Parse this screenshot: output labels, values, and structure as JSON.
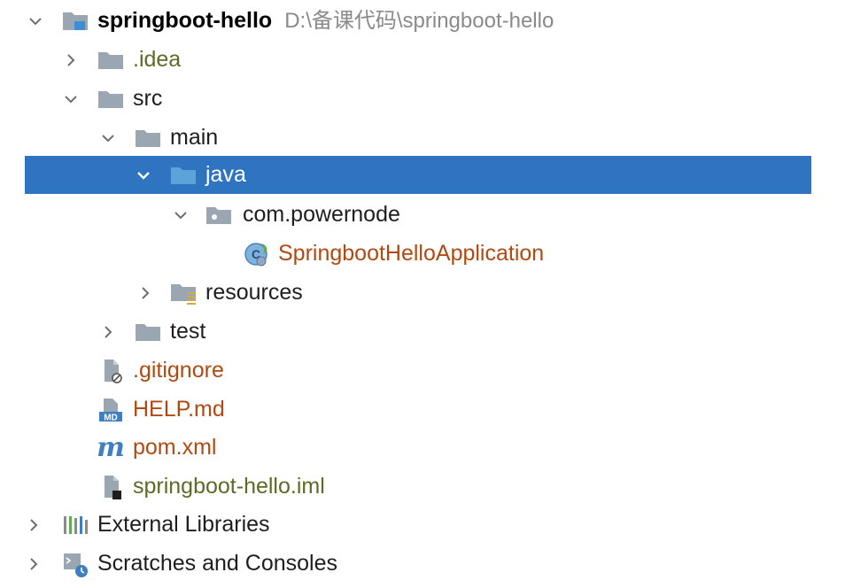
{
  "tree": {
    "root": {
      "name": "springboot-hello",
      "path": "D:\\备课代码\\springboot-hello",
      "expanded": true,
      "icon": "module-folder-icon"
    },
    "idea": {
      "name": ".idea",
      "expanded": false,
      "icon": "folder-icon"
    },
    "src": {
      "name": "src",
      "expanded": true,
      "icon": "folder-icon"
    },
    "main": {
      "name": "main",
      "expanded": true,
      "icon": "folder-icon"
    },
    "java": {
      "name": "java",
      "expanded": true,
      "selected": true,
      "icon": "source-root-folder-icon"
    },
    "package": {
      "name": "com.powernode",
      "expanded": true,
      "icon": "package-icon"
    },
    "app_class": {
      "name": "SpringbootHelloApplication",
      "icon": "spring-boot-class-icon"
    },
    "resources": {
      "name": "resources",
      "expanded": false,
      "icon": "resources-folder-icon"
    },
    "test": {
      "name": "test",
      "expanded": false,
      "icon": "folder-icon"
    },
    "gitignore": {
      "name": ".gitignore",
      "icon": "ignored-file-icon"
    },
    "help_md": {
      "name": "HELP.md",
      "icon": "markdown-file-icon"
    },
    "pom": {
      "name": "pom.xml",
      "icon": "maven-icon"
    },
    "iml": {
      "name": "springboot-hello.iml",
      "icon": "iml-file-icon"
    },
    "external_libraries": {
      "name": "External Libraries",
      "expanded": false,
      "icon": "libraries-icon"
    },
    "scratches": {
      "name": "Scratches and Consoles",
      "expanded": false,
      "icon": "scratches-icon"
    }
  },
  "colors": {
    "selection": "#2f74c0",
    "folder": "#9aa7b3",
    "source_folder": "#5ba3d9",
    "vcs_unversioned": "#b04a12",
    "vcs_ignored": "#5c6b26",
    "path_gray": "#8a8a8a"
  }
}
